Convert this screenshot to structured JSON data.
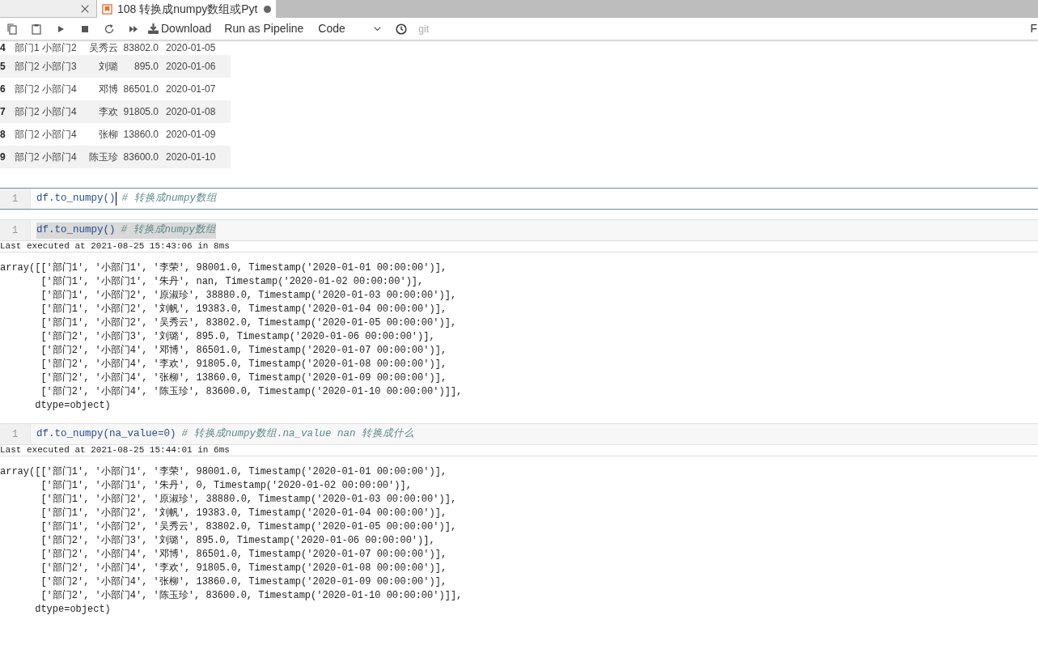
{
  "tabs": [
    {
      "selected": false,
      "dirty": false
    },
    {
      "title": "108 转换成numpy数组或Pyt",
      "selected": true,
      "dirty": true
    }
  ],
  "toolbar": {
    "download": "Download",
    "pipeline": "Run as Pipeline",
    "cell_type": "Code",
    "git": "git",
    "right_edge": "F"
  },
  "table": {
    "rows": [
      {
        "index": "4",
        "cells": [
          "部门1",
          "小部门2",
          "吴秀云",
          "83802.0",
          "2020-01-05"
        ]
      },
      {
        "index": "5",
        "cells": [
          "部门2",
          "小部门3",
          "刘璐",
          "895.0",
          "2020-01-06"
        ]
      },
      {
        "index": "6",
        "cells": [
          "部门2",
          "小部门4",
          "邓博",
          "86501.0",
          "2020-01-07"
        ]
      },
      {
        "index": "7",
        "cells": [
          "部门2",
          "小部门4",
          "李欢",
          "91805.0",
          "2020-01-08"
        ]
      },
      {
        "index": "8",
        "cells": [
          "部门2",
          "小部门4",
          "张柳",
          "13860.0",
          "2020-01-09"
        ]
      },
      {
        "index": "9",
        "cells": [
          "部门2",
          "小部门4",
          "陈玉珍",
          "83600.0",
          "2020-01-10"
        ]
      }
    ]
  },
  "cells": [
    {
      "kind": "editing",
      "line_number": "1",
      "code": "df.to_numpy()",
      "comment": "# 转换成numpy数组"
    },
    {
      "kind": "executed",
      "line_number": "1",
      "code": "df.to_numpy()",
      "comment": "# 转换成numpy数组",
      "text_selected": true,
      "last_executed": "Last executed at 2021-08-25 15:43:06 in 8ms",
      "output": [
        "array([['部门1', '小部门1', '李荣', 98001.0, Timestamp('2020-01-01 00:00:00')],",
        "       ['部门1', '小部门1', '朱丹', nan, Timestamp('2020-01-02 00:00:00')],",
        "       ['部门1', '小部门2', '原淑珍', 38880.0, Timestamp('2020-01-03 00:00:00')],",
        "       ['部门1', '小部门2', '刘帆', 19383.0, Timestamp('2020-01-04 00:00:00')],",
        "       ['部门1', '小部门2', '吴秀云', 83802.0, Timestamp('2020-01-05 00:00:00')],",
        "       ['部门2', '小部门3', '刘璐', 895.0, Timestamp('2020-01-06 00:00:00')],",
        "       ['部门2', '小部门4', '邓博', 86501.0, Timestamp('2020-01-07 00:00:00')],",
        "       ['部门2', '小部门4', '李欢', 91805.0, Timestamp('2020-01-08 00:00:00')],",
        "       ['部门2', '小部门4', '张柳', 13860.0, Timestamp('2020-01-09 00:00:00')],",
        "       ['部门2', '小部门4', '陈玉珍', 83600.0, Timestamp('2020-01-10 00:00:00')]],",
        "      dtype=object)"
      ]
    },
    {
      "kind": "executed",
      "line_number": "1",
      "code": "df.to_numpy(na_value=0)",
      "comment": "# 转换成numpy数组.na_value nan 转换成什么",
      "text_selected": false,
      "last_executed": "Last executed at 2021-08-25 15:44:01 in 6ms",
      "output": [
        "array([['部门1', '小部门1', '李荣', 98001.0, Timestamp('2020-01-01 00:00:00')],",
        "       ['部门1', '小部门1', '朱丹', 0, Timestamp('2020-01-02 00:00:00')],",
        "       ['部门1', '小部门2', '原淑珍', 38880.0, Timestamp('2020-01-03 00:00:00')],",
        "       ['部门1', '小部门2', '刘帆', 19383.0, Timestamp('2020-01-04 00:00:00')],",
        "       ['部门1', '小部门2', '吴秀云', 83802.0, Timestamp('2020-01-05 00:00:00')],",
        "       ['部门2', '小部门3', '刘璐', 895.0, Timestamp('2020-01-06 00:00:00')],",
        "       ['部门2', '小部门4', '邓博', 86501.0, Timestamp('2020-01-07 00:00:00')],",
        "       ['部门2', '小部门4', '李欢', 91805.0, Timestamp('2020-01-08 00:00:00')],",
        "       ['部门2', '小部门4', '张柳', 13860.0, Timestamp('2020-01-09 00:00:00')],",
        "       ['部门2', '小部门4', '陈玉珍', 83600.0, Timestamp('2020-01-10 00:00:00')]],",
        "      dtype=object)"
      ]
    }
  ]
}
